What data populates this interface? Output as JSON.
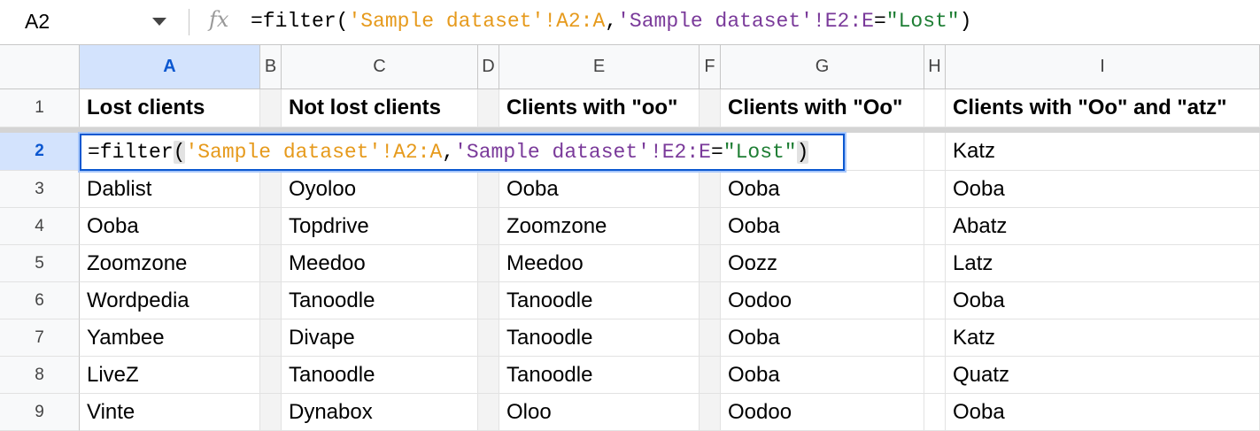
{
  "formula_bar": {
    "name_box": "A2",
    "fx_label": "fx",
    "formula": {
      "prefix": "=filter",
      "open": "(",
      "arg1": "'Sample dataset'!A2:A",
      "comma": ",",
      "arg2": "'Sample dataset'!E2:E",
      "eq": "=",
      "arg3": "\"Lost\"",
      "close": ")"
    }
  },
  "columns": [
    "A",
    "B",
    "C",
    "D",
    "E",
    "F",
    "G",
    "H",
    "I"
  ],
  "row_numbers": [
    "1",
    "2",
    "3",
    "4",
    "5",
    "6",
    "7",
    "8",
    "9"
  ],
  "header_row": {
    "A": "Lost clients",
    "C": "Not lost clients",
    "E": "Clients with \"oo\"",
    "G": "Clients with \"Oo\"",
    "I": "Clients with \"Oo\" and \"atz\""
  },
  "row2": {
    "I": "Katz"
  },
  "rows": [
    {
      "A": "Dablist",
      "C": "Oyoloo",
      "E": "Ooba",
      "G": "Ooba",
      "I": "Ooba"
    },
    {
      "A": "Ooba",
      "C": "Topdrive",
      "E": "Zoomzone",
      "G": "Ooba",
      "I": "Abatz"
    },
    {
      "A": "Zoomzone",
      "C": "Meedoo",
      "E": "Meedoo",
      "G": "Oozz",
      "I": "Latz"
    },
    {
      "A": "Wordpedia",
      "C": "Tanoodle",
      "E": "Tanoodle",
      "G": "Oodoo",
      "I": "Ooba"
    },
    {
      "A": "Yambee",
      "C": "Divape",
      "E": "Tanoodle",
      "G": "Ooba",
      "I": "Katz"
    },
    {
      "A": "LiveZ",
      "C": "Tanoodle",
      "E": "Tanoodle",
      "G": "Ooba",
      "I": "Quatz"
    },
    {
      "A": "Vinte",
      "C": "Dynabox",
      "E": "Oloo",
      "G": "Oodoo",
      "I": "Ooba"
    }
  ],
  "colors": {
    "selection": "#0b57d0",
    "string1": "#e69a1c",
    "string2": "#7a3a9a",
    "string3": "#1e7e34"
  }
}
